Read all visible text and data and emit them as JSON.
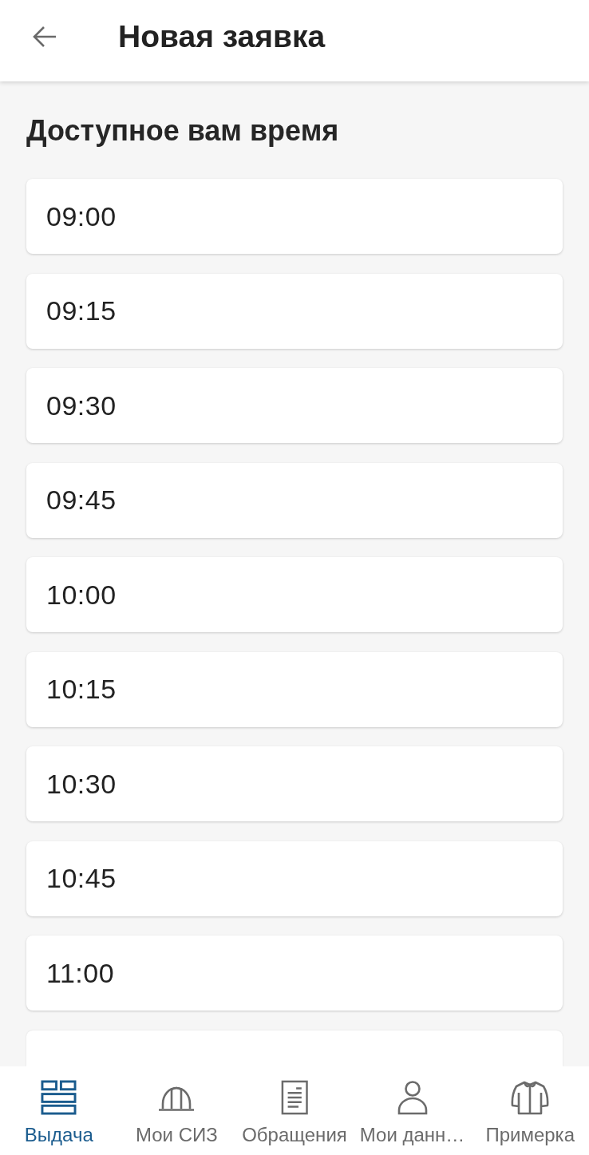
{
  "app_bar": {
    "title": "Новая заявка"
  },
  "section": {
    "title": "Доступное вам время",
    "slots": [
      {
        "time": "09:00"
      },
      {
        "time": "09:15"
      },
      {
        "time": "09:30"
      },
      {
        "time": "09:45"
      },
      {
        "time": "10:00"
      },
      {
        "time": "10:15"
      },
      {
        "time": "10:30"
      },
      {
        "time": "10:45"
      },
      {
        "time": "11:00"
      }
    ],
    "list_continues": true
  },
  "bottom_nav": [
    {
      "kind": "issue",
      "label": "Выдача",
      "selected": true
    },
    {
      "kind": "helmet",
      "label": "Мои СИЗ",
      "selected": false
    },
    {
      "kind": "document",
      "label": "Обращения",
      "selected": false
    },
    {
      "kind": "profile",
      "label": "Мои данн…",
      "selected": false
    },
    {
      "kind": "jacket",
      "label": "Примерка",
      "selected": false
    }
  ]
}
